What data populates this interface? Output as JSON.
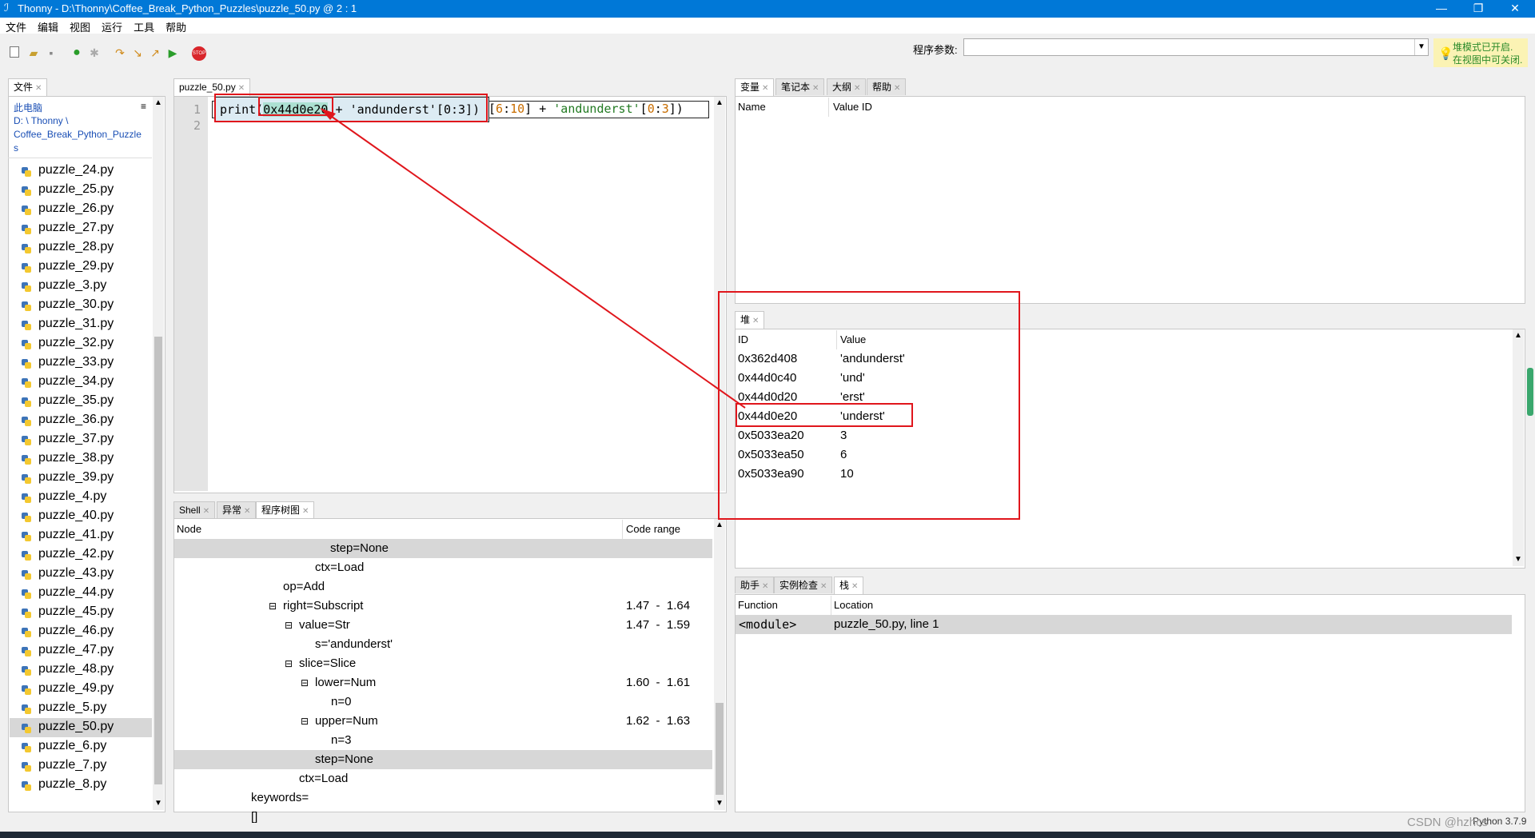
{
  "window": {
    "title": "Thonny  -  D:\\Thonny\\Coffee_Break_Python_Puzzles\\puzzle_50.py  @  2 : 1",
    "min": "—",
    "max": "❐",
    "close": "✕"
  },
  "menu": [
    "文件",
    "编辑",
    "视图",
    "运行",
    "工具",
    "帮助"
  ],
  "toolbar": {
    "program_args_label": "程序参数:",
    "program_args_value": "",
    "notice_line1": "堆模式已开启.",
    "notice_line2": "在视图中可关闭."
  },
  "files_panel": {
    "tab": "文件",
    "location_label": "此电脑",
    "path_line1": "D: \\ Thonny \\",
    "path_line2": "Coffee_Break_Python_Puzzle",
    "path_line3": "s",
    "files": [
      "puzzle_24.py",
      "puzzle_25.py",
      "puzzle_26.py",
      "puzzle_27.py",
      "puzzle_28.py",
      "puzzle_29.py",
      "puzzle_3.py",
      "puzzle_30.py",
      "puzzle_31.py",
      "puzzle_32.py",
      "puzzle_33.py",
      "puzzle_34.py",
      "puzzle_35.py",
      "puzzle_36.py",
      "puzzle_37.py",
      "puzzle_38.py",
      "puzzle_39.py",
      "puzzle_4.py",
      "puzzle_40.py",
      "puzzle_41.py",
      "puzzle_42.py",
      "puzzle_43.py",
      "puzzle_44.py",
      "puzzle_45.py",
      "puzzle_46.py",
      "puzzle_47.py",
      "puzzle_48.py",
      "puzzle_49.py",
      "puzzle_5.py",
      "puzzle_50.py",
      "puzzle_6.py",
      "puzzle_7.py",
      "puzzle_8.py"
    ],
    "selected": "puzzle_50.py"
  },
  "editor": {
    "tab": "puzzle_50.py",
    "line_numbers": [
      "1",
      "2"
    ],
    "eval_box": {
      "print": "print(",
      "address": "0x44d0e20",
      "plus": " + ",
      "str": "'andunderst'",
      "slice": "[0:3])"
    },
    "behind": {
      "open": "[",
      "a": "6",
      "colon1": ":",
      "b": "10",
      "close": "]",
      "plus": " + ",
      "str": "'andunderst'",
      "open2": "[",
      "c": "0",
      "colon2": ":",
      "d": "3",
      "close2": "])"
    }
  },
  "bottom_left": {
    "tabs": [
      "Shell",
      "异常",
      "程序树图"
    ],
    "col_node": "Node",
    "col_range": "Code range",
    "rows": [
      {
        "text": "step=None",
        "range": "",
        "toggle": ""
      },
      {
        "text": "ctx=Load",
        "range": "",
        "toggle": ""
      },
      {
        "text": "op=Add",
        "range": "",
        "toggle": ""
      },
      {
        "text": "right=Subscript",
        "range": "1.47  -  1.64",
        "toggle": "⊟"
      },
      {
        "text": "value=Str",
        "range": "1.47  -  1.59",
        "toggle": "⊟"
      },
      {
        "text": "s='andunderst'",
        "range": "",
        "toggle": ""
      },
      {
        "text": "slice=Slice",
        "range": "",
        "toggle": "⊟"
      },
      {
        "text": "lower=Num",
        "range": "1.60  -  1.61",
        "toggle": "⊟"
      },
      {
        "text": "n=0",
        "range": "",
        "toggle": ""
      },
      {
        "text": "upper=Num",
        "range": "1.62  -  1.63",
        "toggle": "⊟"
      },
      {
        "text": "n=3",
        "range": "",
        "toggle": ""
      },
      {
        "text": "step=None",
        "range": "",
        "toggle": ""
      },
      {
        "text": "ctx=Load",
        "range": "",
        "toggle": ""
      },
      {
        "text": "keywords=[]",
        "range": "",
        "toggle": ""
      }
    ]
  },
  "variables": {
    "tabs": [
      "变量",
      "笔记本",
      "大纲",
      "帮助"
    ],
    "col_name": "Name",
    "col_value_id": "Value ID"
  },
  "heap": {
    "tab": "堆",
    "col_id": "ID",
    "col_value": "Value",
    "rows": [
      {
        "id": "0x362d408",
        "value": "'andunderst'"
      },
      {
        "id": "0x44d0c40",
        "value": "'und'"
      },
      {
        "id": "0x44d0d20",
        "value": "'erst'"
      },
      {
        "id": "0x44d0e20",
        "value": "'underst'"
      },
      {
        "id": "0x5033ea20",
        "value": "3"
      },
      {
        "id": "0x5033ea50",
        "value": "6"
      },
      {
        "id": "0x5033ea90",
        "value": "10"
      }
    ]
  },
  "stack": {
    "tabs": [
      "助手",
      "实例检查",
      "栈"
    ],
    "col_function": "Function",
    "col_location": "Location",
    "rows": [
      {
        "function": "<module>",
        "location": "puzzle_50.py, line 1"
      }
    ]
  },
  "status": {
    "python_version": "Python 3.7.9",
    "watermark": "CSDN @hzhcs"
  }
}
